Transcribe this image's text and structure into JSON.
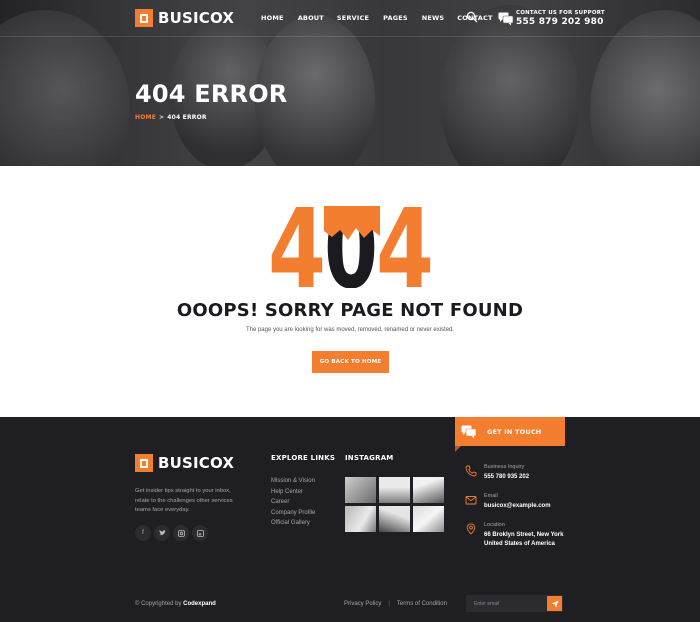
{
  "brand": {
    "name": "BUSICOX"
  },
  "nav": [
    "HOME",
    "ABOUT",
    "SERVICE",
    "PAGES",
    "NEWS",
    "CONTACT"
  ],
  "support": {
    "label": "CONTACT US FOR SUPPORT",
    "phone": "555 879 202 980"
  },
  "hero": {
    "title": "404 ERROR",
    "breadcrumb_home": "HOME",
    "breadcrumb_sep": ">",
    "breadcrumb_current": "404 ERROR"
  },
  "error": {
    "code_left": "4",
    "code_mid": "0",
    "code_right": "4",
    "title": "OOOPS! SORRY PAGE NOT FOUND",
    "description": "The page you are looking for was moved, removed, renamed or never existed.",
    "button": "GO BACK TO HOME"
  },
  "footer": {
    "about": "Get insider tips straight to your inbox, relate to the challenges other services teams face everyday.",
    "socials": [
      "f",
      "t",
      "in",
      "li"
    ],
    "explore_title": "EXPLORE LINKS",
    "explore_links": [
      "Mission & Vision",
      "Help Center",
      "Career",
      "Company Profile",
      "Official Gallery"
    ],
    "instagram_title": "INSTAGRAM",
    "get_in_touch": "GET IN TOUCH",
    "contacts": [
      {
        "icon": "phone-icon",
        "label": "Business Inquiry",
        "value": "555 780 935 202"
      },
      {
        "icon": "email-icon",
        "label": "Email",
        "value": "busicox@example.com"
      },
      {
        "icon": "location-icon",
        "label": "Location",
        "value": "66 Broklyn Street, New York United States of America"
      }
    ],
    "copyright_prefix": "© Copyrighted by",
    "copyright_brand": "Codexpand",
    "privacy": "Privacy Policy",
    "legal_sep": "|",
    "terms": "Terms of Condition",
    "email_placeholder": "Enter email"
  },
  "colors": {
    "accent": "#f47e30",
    "dark": "#1f1f23",
    "text_dark": "#1b1b1f"
  }
}
